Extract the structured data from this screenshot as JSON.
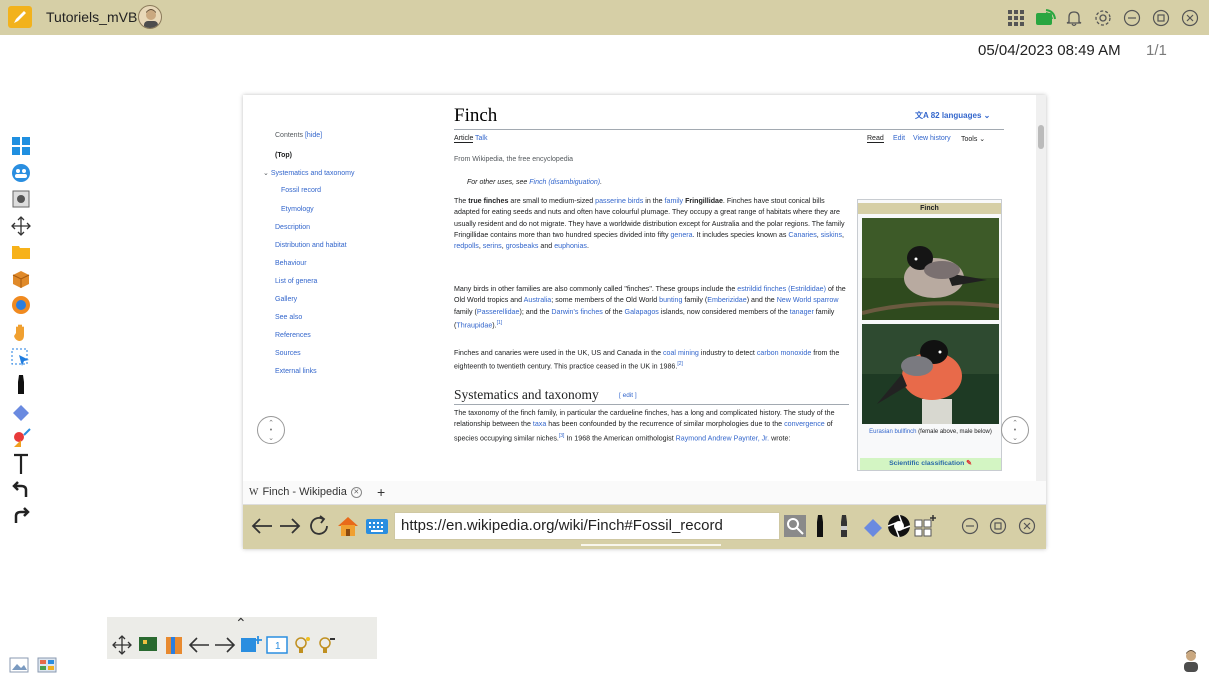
{
  "app": {
    "title": "Tutoriels_mVB",
    "datetime": "05/04/2023 08:49 AM",
    "page_count": "1/1"
  },
  "top_icons": [
    "grid-icon",
    "cast-icon",
    "bell-icon",
    "settings-icon",
    "minimize-icon",
    "restore-icon",
    "close-icon"
  ],
  "left_toolbar": [
    "windows-icon",
    "users-icon",
    "camera-icon",
    "move-icon",
    "folder-icon",
    "box-icon",
    "browser-icon",
    "hand-icon",
    "select-icon",
    "marker-icon",
    "eraser-icon",
    "shapes-icon",
    "text-icon",
    "undo-icon",
    "redo-icon"
  ],
  "wiki": {
    "title": "Finch",
    "languages": "82 languages",
    "tab_article": "Article",
    "tab_talk": "Talk",
    "tab_read": "Read",
    "tab_edit": "Edit",
    "tab_history": "View history",
    "tab_tools": "Tools",
    "from": "From Wikipedia, the free encyclopedia",
    "hatnote_prefix": "For other uses, see ",
    "hatnote_link": "Finch (disambiguation)",
    "hatnote_suffix": ".",
    "para1": {
      "a": "The ",
      "b": "true finches",
      "c": " are small to medium-sized ",
      "d": "passerine birds",
      "e": " in the ",
      "f": "family",
      "g": " ",
      "h": "Fringillidae",
      "i": ". Finches have stout conical bills adapted for eating seeds and nuts and often have colourful plumage. They occupy a great range of habitats where they are usually resident and do not migrate. They have a worldwide distribution except for Australia and the polar regions. The family Fringillidae contains more than two hundred species divided into fifty ",
      "j": "genera",
      "k": ". It includes species known as ",
      "l": "Canaries",
      "m": ", ",
      "n": "siskins",
      "o": ", ",
      "p": "redpolls",
      "q": ", ",
      "r": "serins",
      "s": ", ",
      "t": "grosbeaks",
      "u": " and ",
      "v": "euphonias",
      "w": "."
    },
    "para2": {
      "a": "Many birds in other families are also commonly called \"finches\". These groups include the ",
      "b": "estrildid finches (Estrildidae)",
      "c": " of the Old World tropics and ",
      "d": "Australia",
      "e": "; some members of the Old World ",
      "f": "bunting",
      "g": " family (",
      "h": "Emberizidae",
      "i": ") and the ",
      "j": "New World sparrow",
      "k": " family (",
      "l": "Passerellidae",
      "m": "); and the ",
      "n": "Darwin's finches",
      "o": " of the ",
      "p": "Galapagos",
      "q": " islands, now considered members of the ",
      "r": "tanager",
      "s": " family (",
      "t": "Thraupidae",
      "u": ").",
      "v": "[1]"
    },
    "para3": {
      "a": "Finches and canaries were used in the UK, US and Canada in the ",
      "b": "coal mining",
      "c": " industry to detect ",
      "d": "carbon monoxide",
      "e": " from the eighteenth to twentieth century. This practice ceased in the UK in 1986.",
      "f": "[2]"
    },
    "h2": "Systematics and taxonomy",
    "h2_edit": "[ edit ]",
    "para4": {
      "a": "The taxonomy of the finch family, in particular the cardueline finches, has a long and complicated history. The study of the relationship between the ",
      "b": "taxa",
      "c": " has been confounded by the recurrence of similar morphologies due to the ",
      "d": "convergence",
      "e": " of species occupying similar niches.",
      "f": "[3]",
      "g": " In 1968 the American ornithologist ",
      "h": "Raymond Andrew Paynter, Jr.",
      "i": " wrote:"
    },
    "toc": {
      "header": "Contents",
      "hide": "[hide]",
      "items": [
        "(Top)",
        "Systematics and taxonomy",
        "Fossil record",
        "Etymology",
        "Description",
        "Distribution and habitat",
        "Behaviour",
        "List of genera",
        "Gallery",
        "See also",
        "References",
        "Sources",
        "External links"
      ]
    },
    "infobox": {
      "title": "Finch",
      "caption_link": "Eurasian bullfinch",
      "caption_text": " (female above, male below)",
      "scientific": "Scientific classification"
    }
  },
  "browser": {
    "tab_title": "Finch - Wikipedia",
    "tab_favicon": "W",
    "new_tab": "+",
    "url": "https://en.wikipedia.org/wiki/Finch#Fossil_record"
  },
  "colors": {
    "bar": "#d6cfa6",
    "link": "#3366cc",
    "accent": "#f2b21c"
  }
}
